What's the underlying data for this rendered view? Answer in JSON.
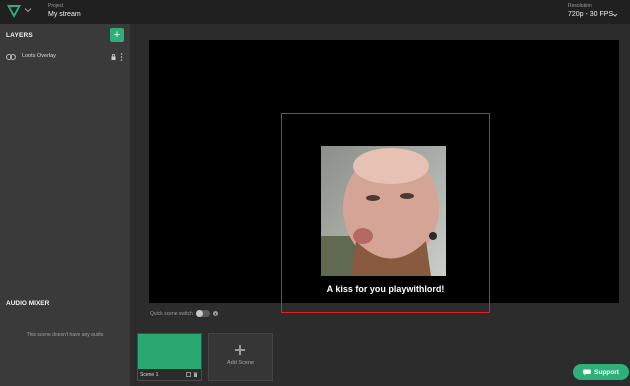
{
  "header": {
    "project_caption": "Project",
    "project_name": "My stream",
    "resolution_caption": "Resolution",
    "resolution_value": "720p - 30 FPS",
    "logo_icon": "logo-icon",
    "colors": {
      "bar": "#202020",
      "accent": "#2fb07a"
    }
  },
  "layers": {
    "title": "LAYERS",
    "add_label": "+",
    "items": [
      {
        "label": "Loots Overlay",
        "icon": "link-icon"
      }
    ]
  },
  "audio_mixer": {
    "title": "AUDIO MIXER",
    "empty_text": "This scene doesn't have any audio"
  },
  "canvas": {
    "caption": "A kiss for you playwithlord!",
    "selection_color": "#e02020"
  },
  "quick_switch": {
    "label": "Quick scene switch"
  },
  "scenes": {
    "items": [
      {
        "label": "Scene 1",
        "thumb_color": "#2aa871"
      }
    ],
    "add_label": "Add Scene"
  },
  "support": {
    "label": "Support"
  }
}
